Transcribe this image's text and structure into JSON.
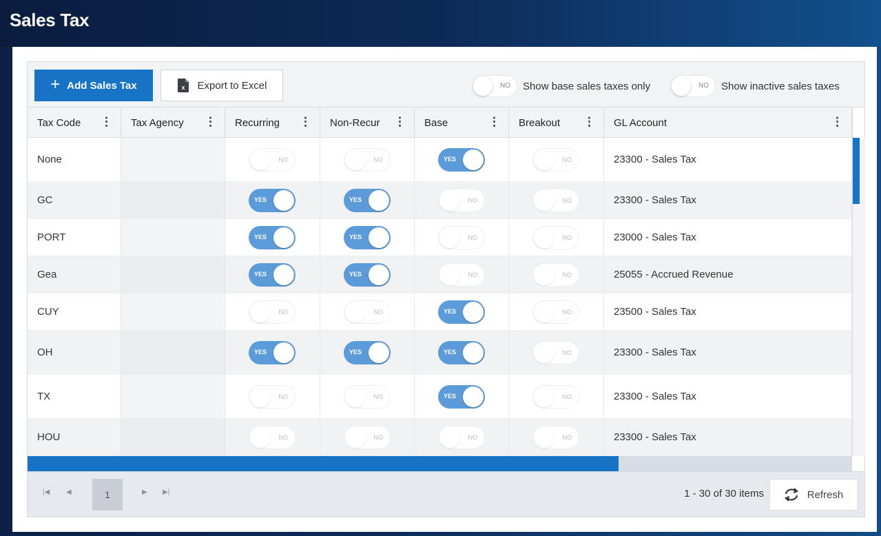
{
  "page": {
    "title": "Sales Tax"
  },
  "toolbar": {
    "add_label": "Add Sales Tax",
    "add_icon": "plus-icon",
    "export_label": "Export to Excel",
    "export_icon": "excel-file-icon",
    "filters": [
      {
        "toggle_text": "NO",
        "label": "Show base sales taxes only"
      },
      {
        "toggle_text": "NO",
        "label": "Show inactive sales taxes"
      }
    ]
  },
  "grid": {
    "columns": [
      "Tax Code",
      "Tax Agency",
      "Recurring",
      "Non-Recur",
      "Base",
      "Breakout",
      "GL Account"
    ],
    "on_text": "YES",
    "off_text": "NO",
    "rows": [
      {
        "tax_code": "None",
        "tax_agency": "",
        "recurring": false,
        "non_recur": false,
        "base": true,
        "breakout": false,
        "gl_account": "23300 - Sales Tax"
      },
      {
        "tax_code": "GC",
        "tax_agency": "",
        "recurring": true,
        "non_recur": true,
        "base": false,
        "breakout": false,
        "gl_account": "23300 - Sales Tax"
      },
      {
        "tax_code": "PORT",
        "tax_agency": "",
        "recurring": true,
        "non_recur": true,
        "base": false,
        "breakout": false,
        "gl_account": "23000 - Sales Tax"
      },
      {
        "tax_code": "Gea",
        "tax_agency": "",
        "recurring": true,
        "non_recur": true,
        "base": false,
        "breakout": false,
        "gl_account": "25055 - Accrued Revenue"
      },
      {
        "tax_code": "CUY",
        "tax_agency": "",
        "recurring": false,
        "non_recur": false,
        "base": true,
        "breakout": false,
        "gl_account": "23500 - Sales Tax"
      },
      {
        "tax_code": "OH",
        "tax_agency": "",
        "recurring": true,
        "non_recur": true,
        "base": true,
        "breakout": false,
        "gl_account": "23300 - Sales Tax"
      },
      {
        "tax_code": "TX",
        "tax_agency": "",
        "recurring": false,
        "non_recur": false,
        "base": true,
        "breakout": false,
        "gl_account": "23300 - Sales Tax"
      },
      {
        "tax_code": "HOU",
        "tax_agency": "",
        "recurring": false,
        "non_recur": false,
        "base": false,
        "breakout": false,
        "gl_account": "23300 - Sales Tax"
      }
    ]
  },
  "pager": {
    "current_page": "1",
    "info": "1 - 30 of 30 items",
    "refresh_label": "Refresh",
    "refresh_icon": "refresh-icon"
  },
  "colors": {
    "header_dark": "#0b2146",
    "primary_blue": "#1673c6",
    "toggle_on": "#5b9bd9"
  }
}
